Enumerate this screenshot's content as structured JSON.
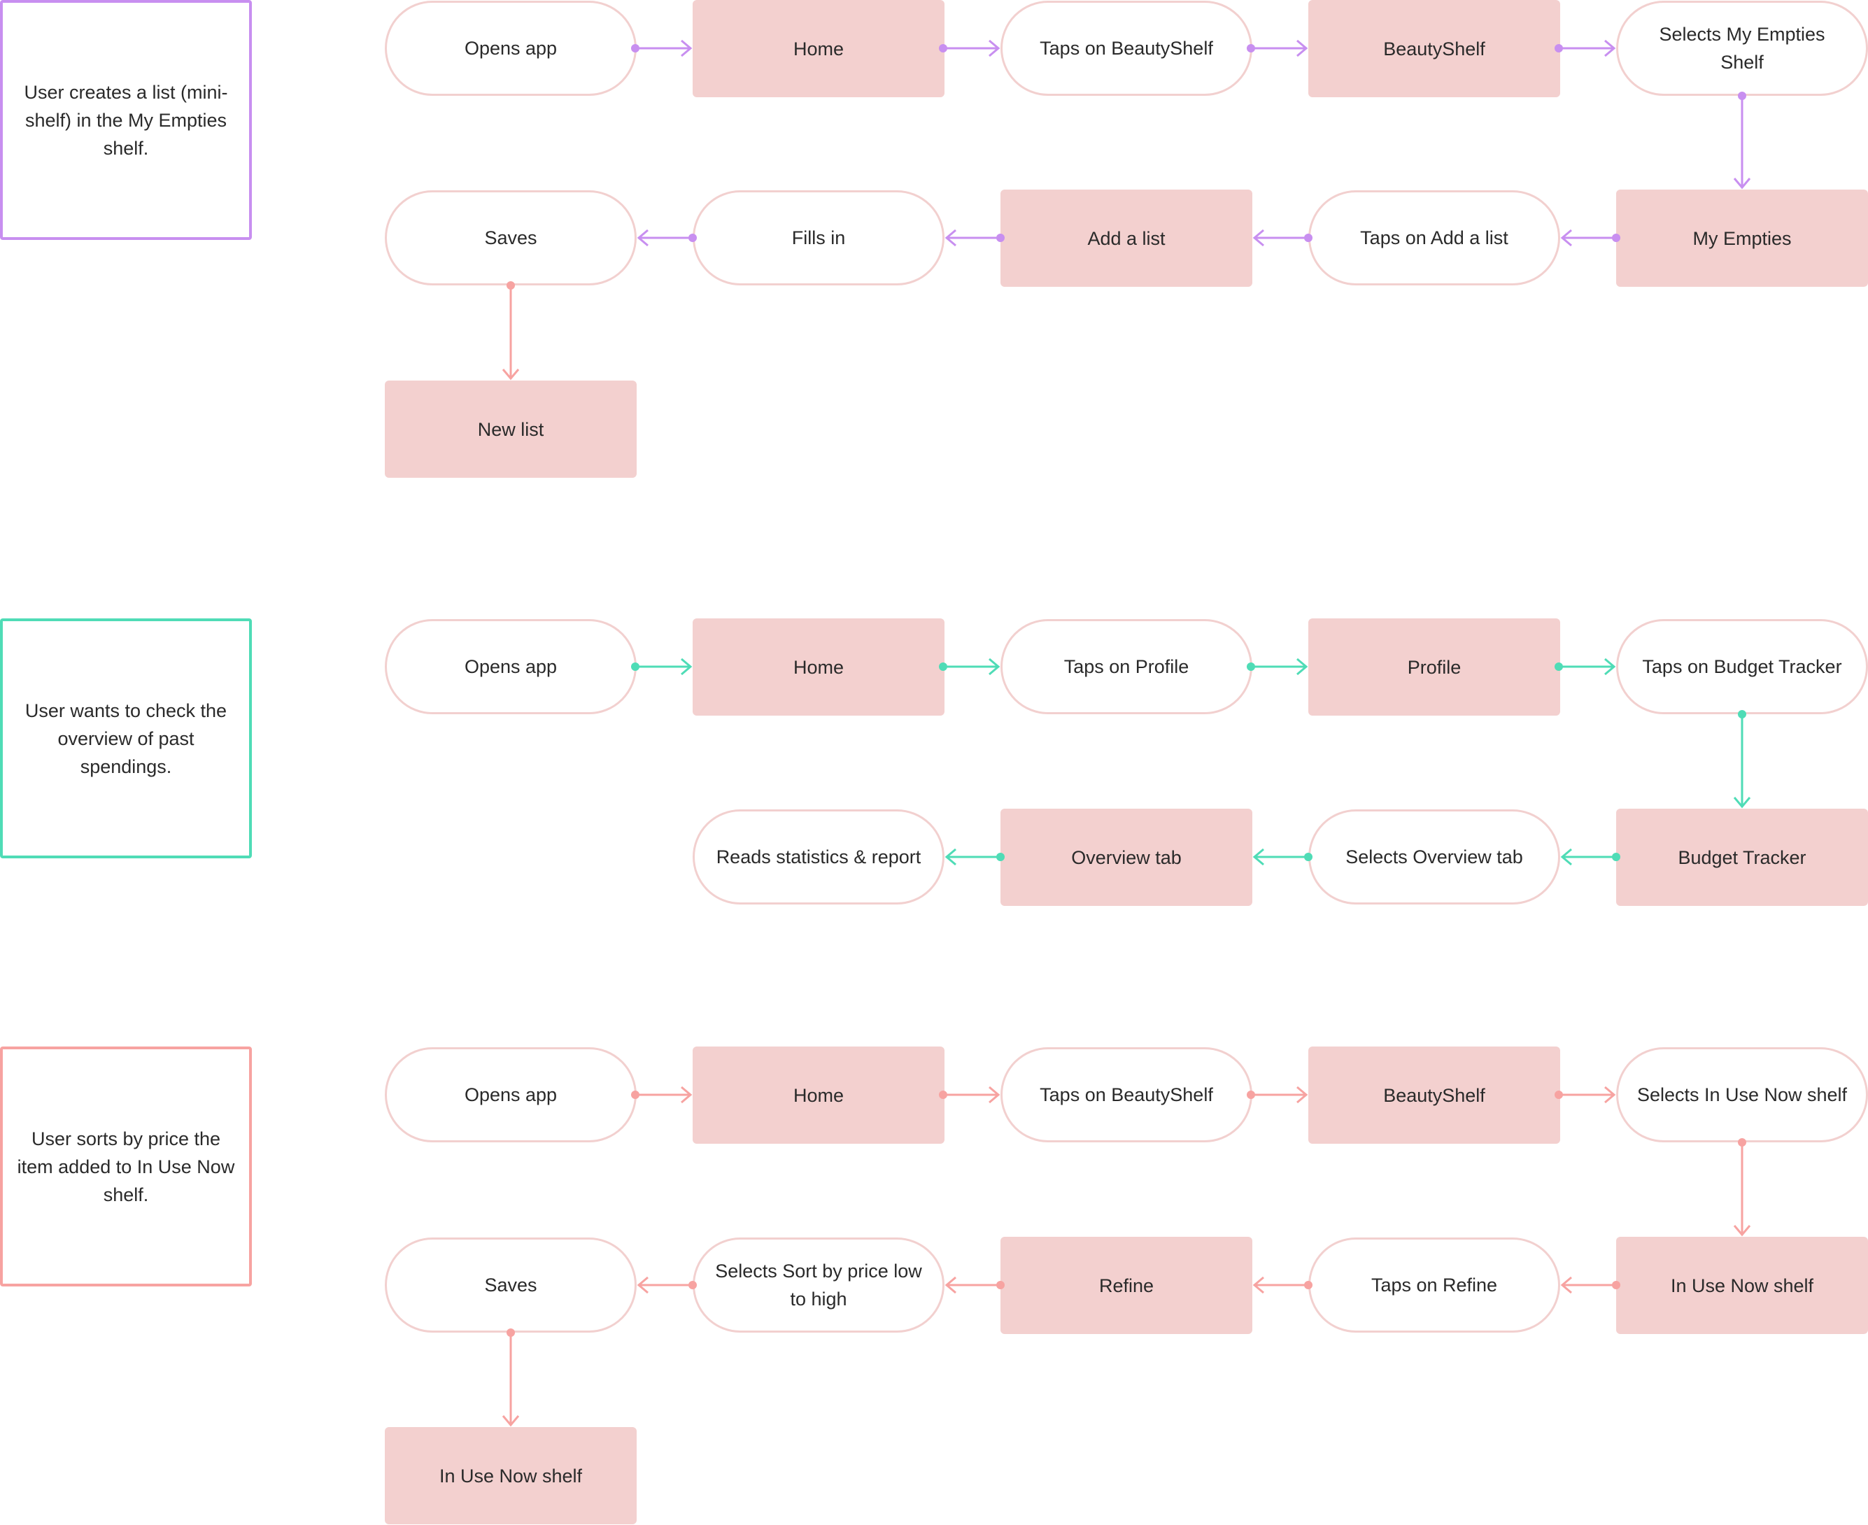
{
  "colors": {
    "flow1": "#c88ff0",
    "flow2": "#4fdcb6",
    "flow3": "#f7a3a1",
    "screen_fill": "#f3d0cf",
    "action_border": "#f2d0cf"
  },
  "flows": [
    {
      "id": "flow1",
      "scenario": "User creates a list (mini-shelf) in the My Empties shelf.",
      "nodes": [
        {
          "id": "f1n1",
          "type": "action",
          "label": "Opens app"
        },
        {
          "id": "f1n2",
          "type": "screen",
          "label": "Home"
        },
        {
          "id": "f1n3",
          "type": "action",
          "label": "Taps on BeautyShelf"
        },
        {
          "id": "f1n4",
          "type": "screen",
          "label": "BeautyShelf"
        },
        {
          "id": "f1n5",
          "type": "action",
          "label": "Selects My Empties Shelf"
        },
        {
          "id": "f1n6",
          "type": "screen",
          "label": "My Empties"
        },
        {
          "id": "f1n7",
          "type": "action",
          "label": "Taps on Add a list"
        },
        {
          "id": "f1n8",
          "type": "screen",
          "label": "Add a list"
        },
        {
          "id": "f1n9",
          "type": "action",
          "label": "Fills in"
        },
        {
          "id": "f1n10",
          "type": "action",
          "label": "Saves"
        },
        {
          "id": "f1n11",
          "type": "screen",
          "label": "New list"
        }
      ]
    },
    {
      "id": "flow2",
      "scenario": "User wants to check the overview of past spendings.",
      "nodes": [
        {
          "id": "f2n1",
          "type": "action",
          "label": "Opens app"
        },
        {
          "id": "f2n2",
          "type": "screen",
          "label": "Home"
        },
        {
          "id": "f2n3",
          "type": "action",
          "label": "Taps on Profile"
        },
        {
          "id": "f2n4",
          "type": "screen",
          "label": "Profile"
        },
        {
          "id": "f2n5",
          "type": "action",
          "label": "Taps on Budget Tracker"
        },
        {
          "id": "f2n6",
          "type": "screen",
          "label": "Budget Tracker"
        },
        {
          "id": "f2n7",
          "type": "action",
          "label": "Selects Overview tab"
        },
        {
          "id": "f2n8",
          "type": "screen",
          "label": "Overview tab"
        },
        {
          "id": "f2n9",
          "type": "action",
          "label": "Reads statistics & report"
        }
      ]
    },
    {
      "id": "flow3",
      "scenario": "User sorts by price the item added to In Use Now shelf.",
      "nodes": [
        {
          "id": "f3n1",
          "type": "action",
          "label": "Opens app"
        },
        {
          "id": "f3n2",
          "type": "screen",
          "label": "Home"
        },
        {
          "id": "f3n3",
          "type": "action",
          "label": "Taps on BeautyShelf"
        },
        {
          "id": "f3n4",
          "type": "screen",
          "label": "BeautyShelf"
        },
        {
          "id": "f3n5",
          "type": "action",
          "label": "Selects In Use Now shelf"
        },
        {
          "id": "f3n6",
          "type": "screen",
          "label": "In Use Now shelf"
        },
        {
          "id": "f3n7",
          "type": "action",
          "label": "Taps on Refine"
        },
        {
          "id": "f3n8",
          "type": "screen",
          "label": "Refine"
        },
        {
          "id": "f3n9",
          "type": "action",
          "label": "Selects Sort by price low to high"
        },
        {
          "id": "f3n10",
          "type": "action",
          "label": "Saves"
        },
        {
          "id": "f3n11",
          "type": "screen",
          "label": "In Use Now shelf"
        }
      ]
    }
  ]
}
